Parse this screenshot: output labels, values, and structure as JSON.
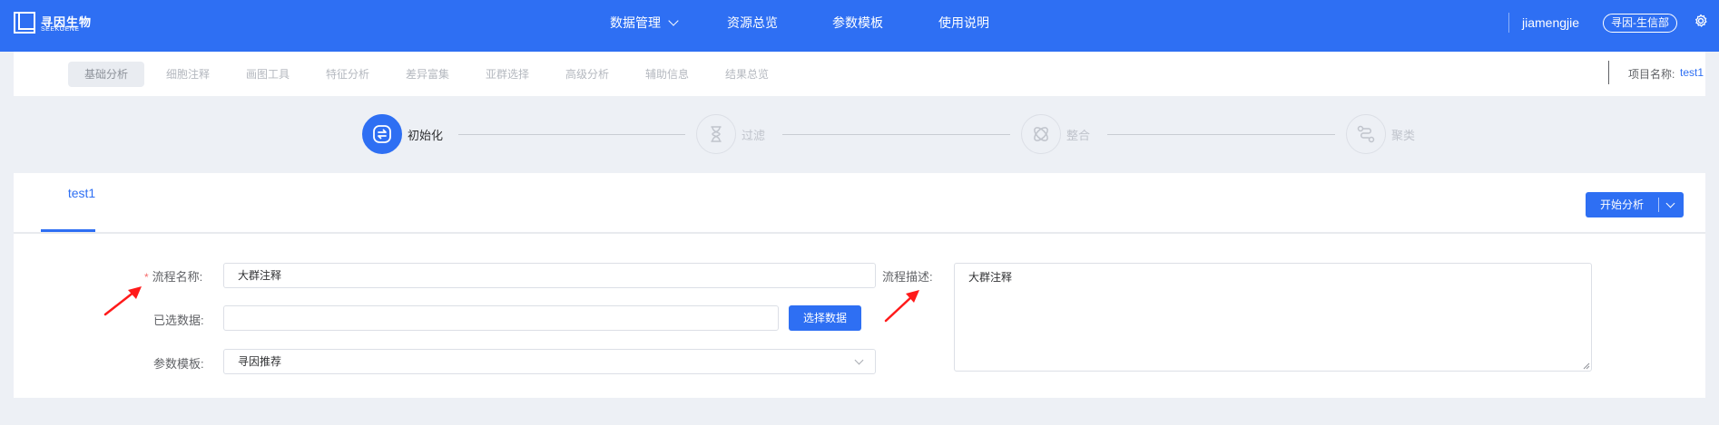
{
  "header": {
    "logo_cn": "寻因生物",
    "logo_en": "SEEKGENE",
    "nav": [
      {
        "label": "数据管理"
      },
      {
        "label": "资源总览"
      },
      {
        "label": "参数模板"
      },
      {
        "label": "使用说明"
      }
    ],
    "username": "jiamengjie",
    "org_badge": "寻因-生信部",
    "icons": [
      "logo-icon",
      "chevron-down-icon",
      "gear-icon"
    ]
  },
  "subtabs": {
    "items": [
      {
        "label": "基础分析",
        "active": true
      },
      {
        "label": "细胞注释"
      },
      {
        "label": "画图工具"
      },
      {
        "label": "特征分析"
      },
      {
        "label": "差异富集"
      },
      {
        "label": "亚群选择"
      },
      {
        "label": "高级分析"
      },
      {
        "label": "辅助信息"
      },
      {
        "label": "结果总览"
      }
    ],
    "project_label": "项目名称:",
    "project_name": "test1"
  },
  "steps": [
    {
      "label": "初始化",
      "active": true,
      "icon": "refresh-icon"
    },
    {
      "label": "过滤",
      "icon": "hourglass-icon"
    },
    {
      "label": "整合",
      "icon": "integrate-icon"
    },
    {
      "label": "聚类",
      "icon": "route-icon"
    }
  ],
  "card": {
    "tab": "test1",
    "start_button": "开始分析",
    "form": {
      "name_label": "流程名称:",
      "name_value": "大群注释",
      "data_label": "已选数据:",
      "data_value": "",
      "select_data_button": "选择数据",
      "template_label": "参数模板:",
      "template_value": "寻因推荐",
      "desc_label": "流程描述:",
      "desc_value": "大群注释"
    }
  },
  "colors": {
    "primary": "#2e6ff3",
    "background": "#edf0f5",
    "required": "#f56c6c",
    "annotation_arrow": "#ff1a1a"
  }
}
